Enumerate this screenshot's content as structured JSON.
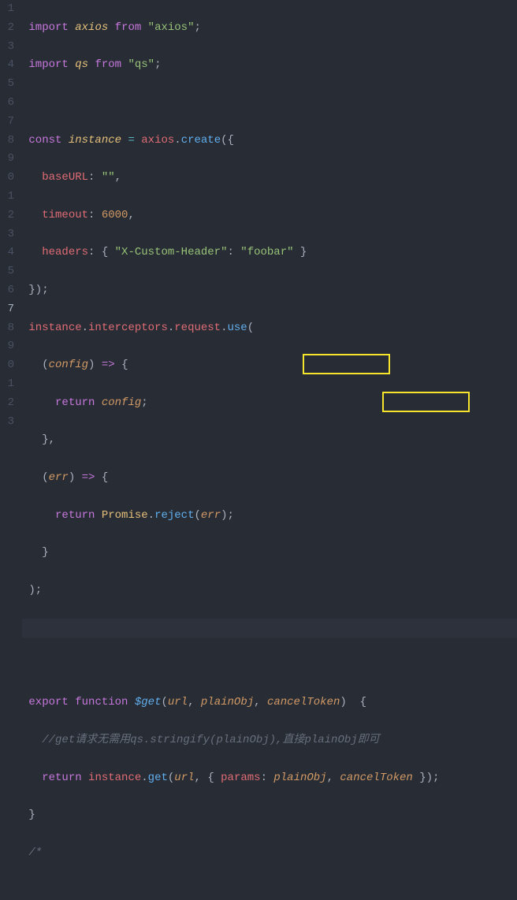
{
  "colors": {
    "bg": "#282c34",
    "fg": "#abb2bf",
    "highlightBorder": "#f5e62b"
  },
  "startLine": 1,
  "currentLine": 17,
  "gutter": [
    "1",
    "2",
    "3",
    "4",
    "5",
    "6",
    "7",
    "8",
    "9",
    "0",
    "1",
    "2",
    "3",
    "4",
    "5",
    "6",
    "7",
    "8",
    "9",
    "0",
    "1",
    "2",
    "3"
  ],
  "code": {
    "l1": {
      "kw_import": "import",
      "id": "axios",
      "kw_from": "from",
      "str": "\"axios\"",
      "semi": ";"
    },
    "l2": {
      "kw_import": "import",
      "id": "qs",
      "kw_from": "from",
      "str": "\"qs\"",
      "semi": ";"
    },
    "l4": {
      "kw_const": "const",
      "id": "instance",
      "eq": "=",
      "obj": "axios",
      "dot": ".",
      "fn": "create",
      "open": "({"
    },
    "l5": {
      "prop": "baseURL",
      "colon": ":",
      "str": "\"\"",
      "comma": ","
    },
    "l6": {
      "prop": "timeout",
      "colon": ":",
      "num": "6000",
      "comma": ","
    },
    "l7": {
      "prop": "headers",
      "colon": ":",
      "open": "{",
      "key": "\"X-Custom-Header\"",
      "colon2": ":",
      "val": "\"foobar\"",
      "close": "}"
    },
    "l8": {
      "close": "});"
    },
    "l9": {
      "inst": "instance",
      "d1": ".",
      "p1": "interceptors",
      "d2": ".",
      "p2": "request",
      "d3": ".",
      "fn": "use",
      "open": "("
    },
    "l10": {
      "open": "(",
      "param": "config",
      "close": ")",
      "arrow": "=>",
      "brace": "{"
    },
    "l11": {
      "kw": "return",
      "id": "config",
      "semi": ";"
    },
    "l12": {
      "close": "},"
    },
    "l13": {
      "open": "(",
      "param": "err",
      "close": ")",
      "arrow": "=>",
      "brace": "{"
    },
    "l14": {
      "kw": "return",
      "cls": "Promise",
      "dot": ".",
      "fn": "reject",
      "open": "(",
      "arg": "err",
      "close": ");"
    },
    "l15": {
      "close": "}"
    },
    "l16": {
      "close": ");"
    },
    "l19": {
      "kw_export": "export",
      "kw_function": "function",
      "name": "$get",
      "open": "(",
      "p1": "url",
      "c1": ",",
      "p2": "plainObj",
      "c2": ",",
      "p3": "cancelToken",
      "close": ")",
      "brace": "{"
    },
    "l20": {
      "cmt": "//get请求无需用qs.stringify(plainObj),直接plainObj即可"
    },
    "l21": {
      "kw": "return",
      "inst": "instance",
      "dot": ".",
      "fn": "get",
      "open": "(",
      "a1": "url",
      "comma": ",",
      "bopen": "{",
      "prop": "params",
      "colon": ":",
      "a2": "plainObj",
      "comma2": ",",
      "a3": "cancelToken",
      "bclose": "});"
    },
    "l22": {
      "close": "}"
    },
    "l23": {
      "cmt": "/*"
    }
  },
  "highlights": [
    {
      "id": "hl1",
      "targets": "cancelToken-param"
    },
    {
      "id": "hl2",
      "targets": "cancelToken-arg"
    }
  ]
}
